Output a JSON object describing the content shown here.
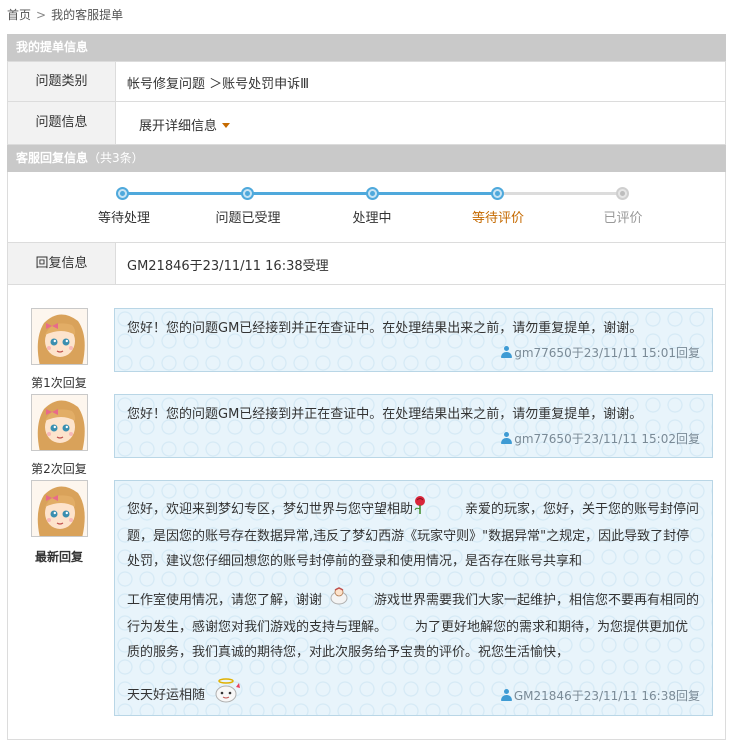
{
  "breadcrumb": {
    "home": "首页",
    "separator": ">",
    "current": "我的客服提单"
  },
  "ticket_section": {
    "title": "我的提单信息"
  },
  "ticket": {
    "category_label": "问题类别",
    "category_value": "帐号修复问题 ＞账号处罚申诉Ⅲ",
    "info_label": "问题信息",
    "expand_label": "展开详细信息"
  },
  "reply_section": {
    "title": "客服回复信息",
    "count": "（共3条）"
  },
  "progress": {
    "steps": [
      "等待处理",
      "问题已受理",
      "处理中",
      "等待评价",
      "已评价"
    ],
    "current_step": 4,
    "colors": {
      "done": "#4fa9dc",
      "current_text": "#c56a00",
      "todo_text": "#999999"
    }
  },
  "reply_info": {
    "label": "回复信息",
    "value": "GM21846于23/11/11 16:38受理"
  },
  "replies": [
    {
      "caption": "第1次回复",
      "text": "您好！您的问题GM已经接到并正在查证中。在处理结果出来之前，请勿重复提单，谢谢。",
      "meta": "gm77650于23/11/11 15:01回复"
    },
    {
      "caption": "第2次回复",
      "text": "您好！您的问题GM已经接到并正在查证中。在处理结果出来之前，请勿重复提单，谢谢。",
      "meta": "gm77650于23/11/11 15:02回复"
    },
    {
      "caption": "最新回复",
      "text_parts": [
        "您好，欢迎来到梦幻专区，梦幻世界与您守望相助",
        "亲爱的玩家，您好，关于您的账号封停问题，是因您的账号存在数据异常,违反了梦幻西游《玩家守则》\"数据异常\"之规定，因此导致了封停处罚，建议您仔细回想您的账号封停前的登录和使用情况，是否存在账号共享和",
        "工作室使用情况，请您了解，谢谢",
        "游戏世界需要我们大家一起维护，相信您不要再有相同的行为发生，感谢您对我们游戏的支持与理解。",
        "为了更好地解您的需求和期待，为您提供更加优质的服务，我们真诚的期待您，对此次服务给予宝贵的评价。祝您生活愉快，",
        "天天好运相随"
      ],
      "meta": "GM21846于23/11/11 16:38回复"
    }
  ],
  "icons": [
    "person-icon",
    "rose-icon",
    "bow-emoji-icon",
    "angel-emoji-icon",
    "caret-down-icon",
    "avatar-girl"
  ]
}
